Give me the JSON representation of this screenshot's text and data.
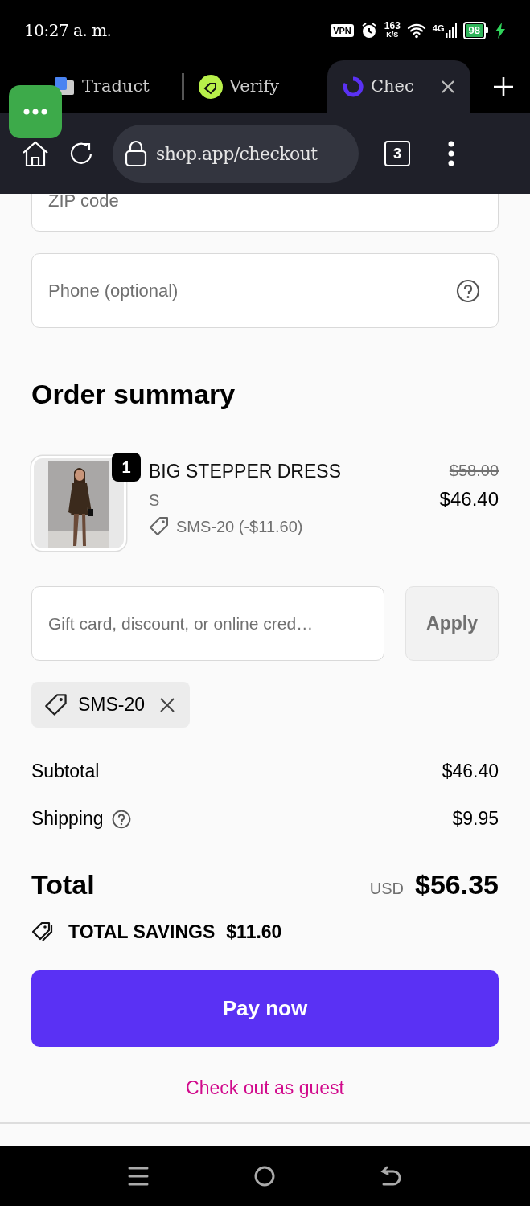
{
  "status_bar": {
    "time": "10:27 a. m.",
    "vpn": "VPN",
    "speed_value": "163",
    "speed_unit": "K/S",
    "network": "4G",
    "battery": "98",
    "charging": true
  },
  "tabs": [
    {
      "title": "Traduct",
      "selected": false
    },
    {
      "title": "Verify",
      "selected": false
    },
    {
      "title": "Chec",
      "selected": true
    }
  ],
  "toolbar": {
    "address": "shop.app/checkout",
    "tab_count": "3"
  },
  "form": {
    "zip_placeholder": "ZIP code",
    "phone_placeholder": "Phone (optional)"
  },
  "order_summary": {
    "title": "Order summary",
    "items": [
      {
        "quantity": "1",
        "name": "BIG STEPPER DRESS",
        "variant": "S",
        "discount": "SMS-20 (-$11.60)",
        "original_price": "$58.00",
        "price": "$46.40"
      }
    ],
    "discount_placeholder": "Gift card, discount, or online cred…",
    "apply": "Apply",
    "codes": [
      "SMS-20"
    ],
    "lines": [
      {
        "label": "Subtotal",
        "value": "$46.40",
        "help": false
      },
      {
        "label": "Shipping",
        "value": "$9.95",
        "help": true
      }
    ],
    "total_label": "Total",
    "currency": "USD",
    "total": "$56.35",
    "savings_label": "TOTAL SAVINGS",
    "savings": "$11.60"
  },
  "pay_button": "Pay now",
  "guest_link": "Check out as guest"
}
